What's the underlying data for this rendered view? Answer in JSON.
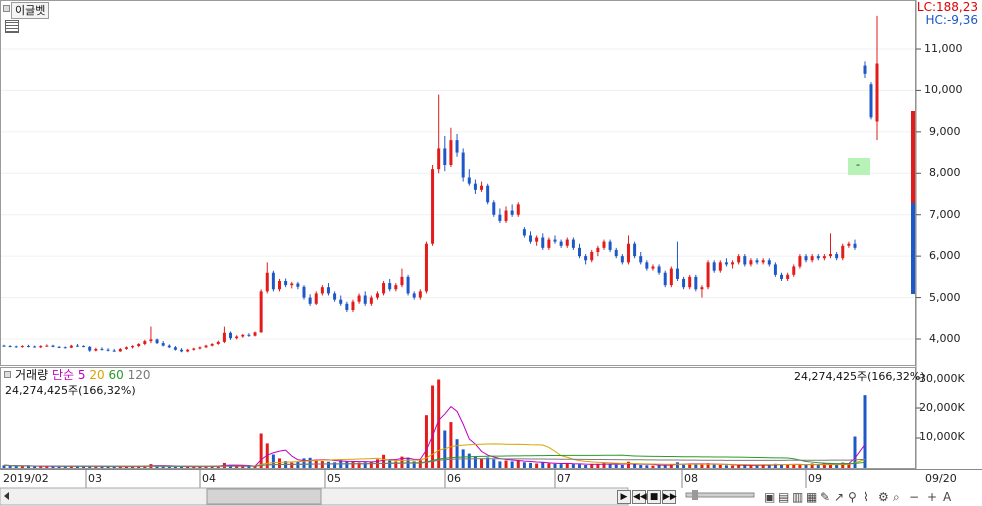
{
  "header": {
    "stock_name": "이글벳",
    "lc_text": "LC:188,23",
    "hc_text": "HC:-9,36",
    "highlight_marker": "-"
  },
  "colors": {
    "up": "#e31b1b",
    "down": "#1e58c8",
    "ma5": "#c000c0",
    "ma20": "#d9a400",
    "ma60": "#2a9a2a",
    "ma120": "#7a7a7a",
    "grid": "#dcdcdc",
    "axis": "#555555"
  },
  "volume_legend": {
    "label": "거래량",
    "type": "단순",
    "p5": "5",
    "p20": "20",
    "p60": "60",
    "p120": "120",
    "value_left": "24,274,425주(166,32%)",
    "value_right": "24,274,425주(166,32%)"
  },
  "axis": {
    "price_ticks": [
      "11,000",
      "10,000",
      "9,000",
      "8,000",
      "7,000",
      "6,000",
      "5,000",
      "4,000"
    ],
    "volume_ticks": [
      "30,000K",
      "20,000K",
      "10,000K"
    ],
    "months": [
      "2019/02",
      "03",
      "04",
      "05",
      "06",
      "07",
      "08",
      "09"
    ],
    "right_date": "09/20"
  },
  "chart_data": [
    {
      "type": "candlestick",
      "title": "이글벳",
      "ylim": [
        3400,
        11500
      ],
      "x_categories": [
        "2019/02",
        "03",
        "04",
        "05",
        "06",
        "07",
        "08",
        "09"
      ],
      "ohlc": [
        [
          3840,
          3860,
          3810,
          3830
        ],
        [
          3830,
          3850,
          3800,
          3820
        ],
        [
          3820,
          3840,
          3790,
          3810
        ],
        [
          3810,
          3850,
          3790,
          3830
        ],
        [
          3830,
          3860,
          3800,
          3820
        ],
        [
          3820,
          3840,
          3790,
          3800
        ],
        [
          3800,
          3850,
          3780,
          3830
        ],
        [
          3830,
          3870,
          3810,
          3840
        ],
        [
          3840,
          3860,
          3800,
          3810
        ],
        [
          3810,
          3830,
          3780,
          3800
        ],
        [
          3800,
          3820,
          3770,
          3790
        ],
        [
          3790,
          3860,
          3780,
          3840
        ],
        [
          3840,
          3880,
          3810,
          3830
        ],
        [
          3830,
          3850,
          3800,
          3810
        ],
        [
          3810,
          3830,
          3690,
          3720
        ],
        [
          3720,
          3790,
          3700,
          3760
        ],
        [
          3760,
          3800,
          3720,
          3740
        ],
        [
          3740,
          3780,
          3700,
          3720
        ],
        [
          3720,
          3760,
          3690,
          3700
        ],
        [
          3700,
          3780,
          3690,
          3760
        ],
        [
          3760,
          3820,
          3740,
          3800
        ],
        [
          3800,
          3850,
          3770,
          3830
        ],
        [
          3830,
          3900,
          3800,
          3880
        ],
        [
          3880,
          3980,
          3850,
          3950
        ],
        [
          3950,
          4300,
          3900,
          3990
        ],
        [
          3990,
          4010,
          3880,
          3900
        ],
        [
          3900,
          3950,
          3820,
          3840
        ],
        [
          3840,
          3870,
          3780,
          3800
        ],
        [
          3800,
          3830,
          3720,
          3740
        ],
        [
          3740,
          3780,
          3680,
          3700
        ],
        [
          3700,
          3760,
          3680,
          3740
        ],
        [
          3740,
          3790,
          3720,
          3770
        ],
        [
          3770,
          3820,
          3750,
          3800
        ],
        [
          3800,
          3860,
          3780,
          3840
        ],
        [
          3840,
          3900,
          3820,
          3880
        ],
        [
          3880,
          3960,
          3860,
          3930
        ],
        [
          3930,
          4300,
          3900,
          4150
        ],
        [
          4150,
          4180,
          3980,
          4020
        ],
        [
          4020,
          4090,
          3990,
          4060
        ],
        [
          4060,
          4120,
          4030,
          4100
        ],
        [
          4100,
          4140,
          4050,
          4080
        ],
        [
          4080,
          4180,
          4060,
          4160
        ],
        [
          4160,
          5200,
          4150,
          5150
        ],
        [
          5150,
          5850,
          5100,
          5600
        ],
        [
          5600,
          5650,
          5150,
          5200
        ],
        [
          5200,
          5450,
          5150,
          5400
        ],
        [
          5400,
          5460,
          5250,
          5300
        ],
        [
          5300,
          5380,
          5220,
          5340
        ],
        [
          5340,
          5380,
          5200,
          5260
        ],
        [
          5260,
          5300,
          4950,
          5000
        ],
        [
          5000,
          5080,
          4800,
          4850
        ],
        [
          4850,
          5150,
          4820,
          5100
        ],
        [
          5100,
          5300,
          5050,
          5250
        ],
        [
          5250,
          5350,
          5050,
          5100
        ],
        [
          5100,
          5150,
          4900,
          4950
        ],
        [
          4950,
          5050,
          4800,
          4850
        ],
        [
          4850,
          4900,
          4650,
          4700
        ],
        [
          4700,
          4950,
          4650,
          4900
        ],
        [
          4900,
          5100,
          4850,
          5050
        ],
        [
          5050,
          5150,
          4800,
          4850
        ],
        [
          4850,
          5050,
          4800,
          5000
        ],
        [
          5000,
          5150,
          4950,
          5100
        ],
        [
          5100,
          5400,
          5050,
          5350
        ],
        [
          5350,
          5450,
          5150,
          5200
        ],
        [
          5200,
          5350,
          5150,
          5300
        ],
        [
          5300,
          5700,
          5250,
          5500
        ],
        [
          5500,
          5550,
          5050,
          5100
        ],
        [
          5100,
          5150,
          4950,
          5000
        ],
        [
          5000,
          5200,
          4950,
          5150
        ],
        [
          5150,
          6350,
          5100,
          6300
        ],
        [
          6300,
          8200,
          6250,
          8100
        ],
        [
          8100,
          9900,
          8000,
          8600
        ],
        [
          8600,
          8900,
          8050,
          8200
        ],
        [
          8200,
          9100,
          8150,
          8800
        ],
        [
          8800,
          8950,
          8400,
          8500
        ],
        [
          8500,
          8600,
          7800,
          7900
        ],
        [
          7900,
          8100,
          7700,
          7750
        ],
        [
          7750,
          7850,
          7500,
          7600
        ],
        [
          7600,
          7800,
          7550,
          7700
        ],
        [
          7700,
          7750,
          7250,
          7300
        ],
        [
          7300,
          7350,
          6950,
          7000
        ],
        [
          7000,
          7150,
          6800,
          6850
        ],
        [
          6850,
          7200,
          6800,
          7100
        ],
        [
          7100,
          7250,
          6950,
          7000
        ],
        [
          7000,
          7300,
          6950,
          7250
        ],
        [
          6650,
          6700,
          6450,
          6500
        ],
        [
          6500,
          6600,
          6300,
          6350
        ],
        [
          6350,
          6500,
          6250,
          6450
        ],
        [
          6450,
          6550,
          6150,
          6200
        ],
        [
          6200,
          6450,
          6150,
          6400
        ],
        [
          6400,
          6500,
          6300,
          6350
        ],
        [
          6350,
          6400,
          6200,
          6250
        ],
        [
          6250,
          6450,
          6200,
          6400
        ],
        [
          6400,
          6450,
          6150,
          6200
        ],
        [
          6200,
          6300,
          5950,
          6000
        ],
        [
          6000,
          6050,
          5800,
          5900
        ],
        [
          5900,
          6150,
          5850,
          6100
        ],
        [
          6100,
          6250,
          6000,
          6200
        ],
        [
          6200,
          6400,
          6150,
          6350
        ],
        [
          6350,
          6400,
          6100,
          6150
        ],
        [
          6150,
          6200,
          5950,
          6000
        ],
        [
          6000,
          6050,
          5800,
          5850
        ],
        [
          5850,
          6500,
          5800,
          6300
        ],
        [
          6300,
          6350,
          5950,
          6000
        ],
        [
          6000,
          6100,
          5800,
          5850
        ],
        [
          5850,
          5900,
          5650,
          5700
        ],
        [
          5700,
          5800,
          5650,
          5750
        ],
        [
          5750,
          5800,
          5550,
          5600
        ],
        [
          5600,
          5650,
          5250,
          5300
        ],
        [
          5300,
          5750,
          5250,
          5700
        ],
        [
          5700,
          6350,
          5400,
          5450
        ],
        [
          5450,
          5500,
          5200,
          5250
        ],
        [
          5250,
          5550,
          5200,
          5500
        ],
        [
          5500,
          5550,
          5150,
          5200
        ],
        [
          5200,
          5300,
          5000,
          5250
        ],
        [
          5250,
          5900,
          5200,
          5850
        ],
        [
          5850,
          5900,
          5600,
          5650
        ],
        [
          5650,
          5900,
          5600,
          5850
        ],
        [
          5850,
          5950,
          5750,
          5800
        ],
        [
          5800,
          5900,
          5700,
          5850
        ],
        [
          5850,
          6050,
          5800,
          6000
        ],
        [
          6000,
          6050,
          5750,
          5800
        ],
        [
          5800,
          5950,
          5750,
          5900
        ],
        [
          5900,
          5950,
          5800,
          5850
        ],
        [
          5850,
          5950,
          5800,
          5900
        ],
        [
          5900,
          5950,
          5750,
          5800
        ],
        [
          5800,
          5850,
          5500,
          5550
        ],
        [
          5550,
          5600,
          5400,
          5450
        ],
        [
          5450,
          5600,
          5400,
          5550
        ],
        [
          5550,
          5800,
          5500,
          5750
        ],
        [
          5750,
          6050,
          5700,
          6000
        ],
        [
          6000,
          6050,
          5850,
          5900
        ],
        [
          5900,
          6050,
          5850,
          6000
        ],
        [
          6000,
          6050,
          5900,
          5950
        ],
        [
          5950,
          6050,
          5900,
          6000
        ],
        [
          6000,
          6550,
          5950,
          6050
        ],
        [
          6050,
          6100,
          5900,
          5950
        ],
        [
          5950,
          6300,
          5900,
          6250
        ],
        [
          6250,
          6350,
          6200,
          6300
        ],
        [
          6300,
          6400,
          6150,
          6200
        ],
        [
          10600,
          10700,
          10300,
          10400
        ],
        [
          10150,
          10200,
          9300,
          9350
        ],
        [
          9250,
          11800,
          8800,
          10650
        ]
      ]
    },
    {
      "type": "bar",
      "title": "거래량",
      "ylim": [
        0,
        32000
      ],
      "unit": "K",
      "volumes": [
        900,
        800,
        600,
        500,
        700,
        600,
        500,
        700,
        600,
        500,
        500,
        600,
        700,
        500,
        700,
        500,
        400,
        400,
        400,
        500,
        500,
        500,
        600,
        800,
        1300,
        700,
        500,
        400,
        500,
        400,
        400,
        500,
        500,
        600,
        700,
        800,
        1700,
        900,
        600,
        500,
        500,
        700,
        11500,
        8200,
        4500,
        3200,
        2300,
        1800,
        2000,
        3200,
        3400,
        2800,
        2300,
        2100,
        1900,
        2600,
        2300,
        2100,
        1800,
        1900,
        2100,
        2900,
        4400,
        2600,
        2200,
        3800,
        3500,
        2200,
        2800,
        17600,
        27500,
        29500,
        12500,
        15300,
        9600,
        6200,
        4800,
        3900,
        3200,
        3500,
        2900,
        2200,
        2500,
        2200,
        2600,
        1900,
        1700,
        1500,
        1900,
        1500,
        1400,
        1300,
        1600,
        1300,
        1200,
        1000,
        1200,
        1400,
        1600,
        1300,
        1100,
        1000,
        2100,
        1200,
        1000,
        900,
        800,
        900,
        1100,
        1300,
        1900,
        1100,
        1400,
        1200,
        1300,
        1600,
        1200,
        1000,
        900,
        800,
        1000,
        900,
        800,
        900,
        1100,
        1000,
        1400,
        1300,
        1100,
        1200,
        1000,
        1100,
        1500,
        1100,
        1600,
        1300,
        1200,
        1800,
        1500,
        10500,
        24274
      ]
    }
  ]
}
